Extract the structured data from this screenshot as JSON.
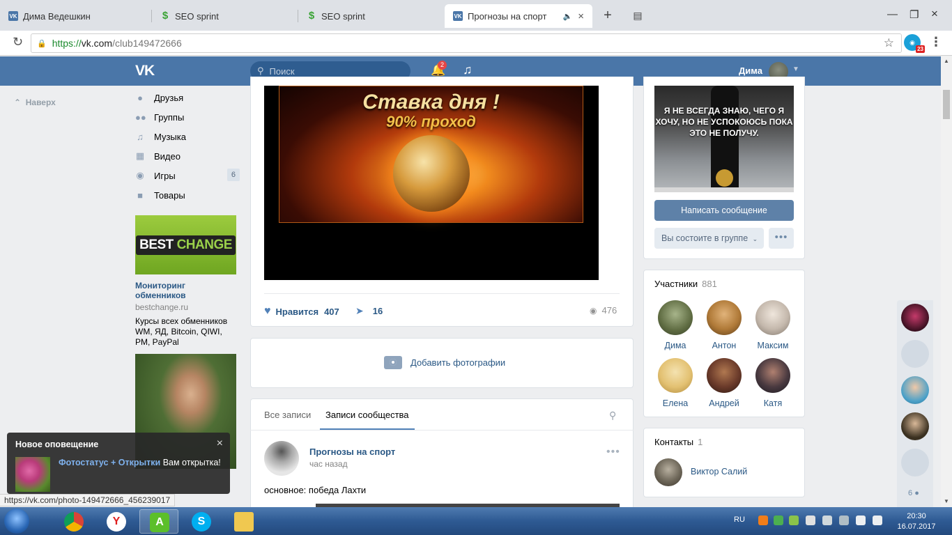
{
  "browser": {
    "tabs": [
      {
        "title": "Дима Ведешкин",
        "favicon": "vk-icon"
      },
      {
        "title": "SEO sprint",
        "favicon": "seosprint-icon"
      },
      {
        "title": "SEO sprint",
        "favicon": "seosprint-icon"
      },
      {
        "title": "Прогнозы на спорт",
        "favicon": "vk-icon",
        "active": true
      }
    ],
    "url": {
      "protocol": "https://",
      "host": "vk.com",
      "path": "/club149472666"
    },
    "extension_badge": "23",
    "status_url": "https://vk.com/photo-149472666_456239017"
  },
  "vk_header": {
    "logo": "VK",
    "search_placeholder": "Поиск",
    "notifications_count": "2",
    "user_name": "Дима"
  },
  "to_top": "Наверх",
  "left_nav": [
    {
      "label": "Друзья",
      "icon": "person-icon"
    },
    {
      "label": "Группы",
      "icon": "people-icon"
    },
    {
      "label": "Музыка",
      "icon": "music-note-icon"
    },
    {
      "label": "Видео",
      "icon": "film-icon"
    },
    {
      "label": "Игры",
      "icon": "gamepad-icon",
      "count": "6"
    },
    {
      "label": "Товары",
      "icon": "bag-icon"
    }
  ],
  "ads": [
    {
      "logo_left": "BEST",
      "logo_right": "CHANGE",
      "title": "Мониторинг обменников",
      "domain": "bestchange.ru",
      "text": "Курсы всех обменников WM, ЯД, Bitcoin, QIWI, PM, PayPal"
    }
  ],
  "post": {
    "banner_line1": "Ставка дня !",
    "banner_line2": "90% проход",
    "likes_label": "Нравится",
    "likes_count": "407",
    "shares_count": "16",
    "views_count": "476"
  },
  "add_photos_label": "Добавить фотографии",
  "wall": {
    "tabs": [
      "Все записи",
      "Записи сообщества"
    ],
    "active_tab": 1,
    "post": {
      "author": "Прогнозы на спорт",
      "time": "час назад",
      "text": "основное: победа Лахти"
    }
  },
  "group": {
    "cover_text": "Я НЕ ВСЕГДА ЗНАЮ, ЧЕГО Я ХОЧУ, НО НЕ УСПОКОЮСЬ ПОКА ЭТО НЕ ПОЛУЧУ.",
    "write_message": "Написать сообщение",
    "member_status": "Вы состоите в группе",
    "members_title": "Участники",
    "members_count": "881",
    "members": [
      {
        "name": "Дима",
        "color": "#7a8a5c"
      },
      {
        "name": "Антон",
        "color": "#c08a3a"
      },
      {
        "name": "Максим",
        "color": "#b8b0a8"
      },
      {
        "name": "Елена",
        "color": "#e6c878"
      },
      {
        "name": "Андрей",
        "color": "#6a3a2a"
      },
      {
        "name": "Катя",
        "color": "#3a3a4a"
      }
    ],
    "contacts_title": "Контакты",
    "contacts_count": "1",
    "contact_name": "Виктор Салий"
  },
  "friends_strip_count": "6",
  "notification": {
    "title": "Новое оповещение",
    "app": "Фотостатус + Открытки",
    "message": "Вам открытка!"
  },
  "taskbar": {
    "lang": "RU",
    "time": "20:30",
    "date": "16.07.2017"
  }
}
